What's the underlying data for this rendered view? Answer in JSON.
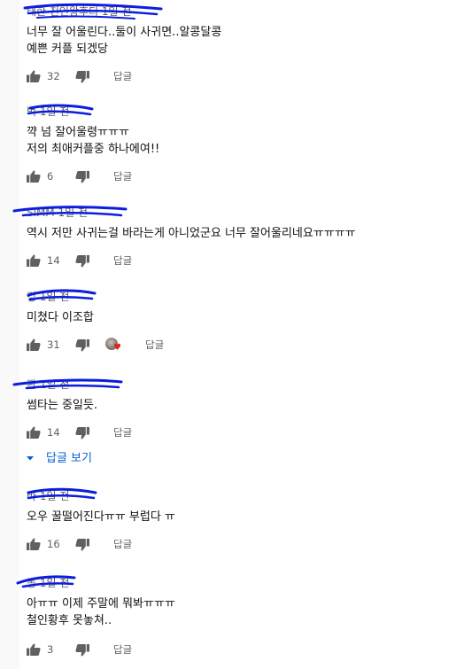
{
  "comments": [
    {
      "author": "태한 친인왕후티 ",
      "time": "1일 전",
      "lines": [
        "너무 잘 어울린다..둘이 사귀면..알콩달콩",
        "예쁜 커플 되겠당"
      ],
      "likes": "32",
      "reply": "답글"
    },
    {
      "author": "벅 ",
      "time": "1일 전",
      "lines": [
        "꺅 넘 잘어울령ㅠㅠㅠ",
        "저의 최애커플중 하나에여!!"
      ],
      "likes": "6",
      "reply": "답글"
    },
    {
      "author": "SiMM",
      "time": "1일 전",
      "lines": [
        "역시 저만 사귀는걸 바라는게 아니었군요 너무 잘어울리네요ㅠㅠㅠㅠ"
      ],
      "likes": "14",
      "reply": "답글"
    },
    {
      "author": "깅 ",
      "time": "1일 전",
      "lines": [
        "미쳤다 이조합"
      ],
      "likes": "31",
      "reply": "답글"
    },
    {
      "author": "꽌 ",
      "time": "1일 전",
      "lines": [
        "썸타는 중일듯."
      ],
      "likes": "14",
      "reply": "답글"
    },
    {
      "author": "바 ",
      "time": "1일 전",
      "lines": [
        "오우 꿀떨어진다ㅠㅠ 부럽다 ㅠ"
      ],
      "likes": "16",
      "reply": "답글"
    },
    {
      "author": "동 ",
      "time": "1일 전",
      "lines": [
        "아ㅠㅠ 이제 주말에 뭐봐ㅠㅠㅠ",
        "철인황후 못놓쳐.."
      ],
      "likes": "3",
      "reply": "답글"
    }
  ],
  "view_replies": {
    "label": "답글 보기"
  },
  "colors": {
    "link": "#065fd4",
    "scribble": "#0b1de0",
    "heart": "#e0221c",
    "muted": "#606060"
  },
  "icons": {
    "like": "thumbs-up-icon",
    "dislike": "thumbs-down-icon",
    "expand": "caret-down-icon",
    "creator_heart": "heart-icon"
  }
}
